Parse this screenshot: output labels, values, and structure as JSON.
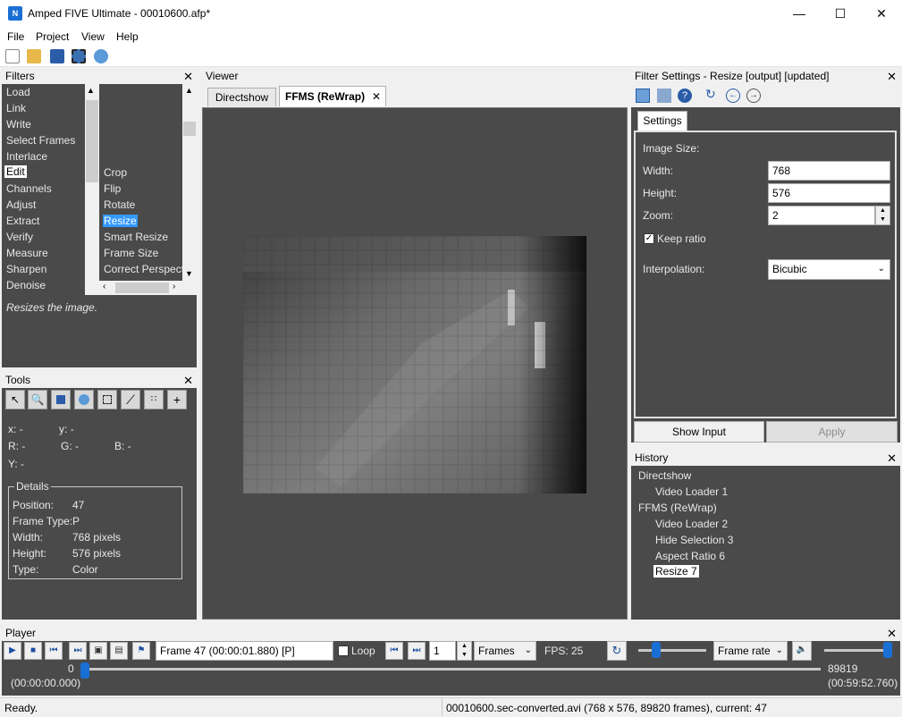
{
  "window": {
    "title": "Amped FIVE Ultimate - 00010600.afp*",
    "icon_text": "N",
    "minimize_icon": "minimize-icon",
    "maximize_icon": "maximize-icon",
    "close_icon": "close-icon"
  },
  "menu": [
    "File",
    "Project",
    "View",
    "Help"
  ],
  "toolbar": {
    "icons": [
      "new-file-icon",
      "open-folder-icon",
      "save-icon",
      "film-icon",
      "globe-icon"
    ]
  },
  "filters": {
    "title": "Filters",
    "categories": [
      "Load",
      "Link",
      "Write",
      "Select Frames",
      "Interlace",
      "Edit",
      "Channels",
      "Adjust",
      "Extract",
      "Verify",
      "Measure",
      "Sharpen",
      "Denoise"
    ],
    "selected_category": "Edit",
    "items": [
      "Crop",
      "Flip",
      "Rotate",
      "Resize",
      "Smart Resize",
      "Frame Size",
      "Correct Perspect"
    ],
    "selected_item": "Resize",
    "description": "Resizes the image."
  },
  "tools": {
    "title": "Tools",
    "icons": [
      "pointer-icon",
      "zoom-icon",
      "picture-icon",
      "globe-icon",
      "rect-select-icon",
      "line-icon",
      "dots-icon",
      "crosshair-icon"
    ],
    "x_label": "x:",
    "x_value": "-",
    "y_label": "y:",
    "y_value": "-",
    "r_label": "R:",
    "r_value": "-",
    "g_label": "G:",
    "g_value": "-",
    "b_label": "B:",
    "b_value": "-",
    "Y_label": "Y:",
    "Y_value": "-",
    "details_title": "Details",
    "details": [
      {
        "label": "Position:",
        "value": "47"
      },
      {
        "label": "Frame Type:",
        "value": "P"
      },
      {
        "label": "Width:",
        "value": "768 pixels"
      },
      {
        "label": "Height:",
        "value": "576 pixels"
      },
      {
        "label": "Type:",
        "value": "Color"
      }
    ]
  },
  "viewer": {
    "title": "Viewer",
    "tabs": [
      "Directshow",
      "FFMS (ReWrap)"
    ],
    "active_tab": "FFMS (ReWrap)",
    "tab_close_icon": "close-icon"
  },
  "filter_settings": {
    "title": "Filter Settings - Resize [output] [updated]",
    "tab": "Settings",
    "image_size_label": "Image Size:",
    "width_label": "Width:",
    "width_value": "768",
    "height_label": "Height:",
    "height_value": "576",
    "zoom_label": "Zoom:",
    "zoom_value": "2",
    "keep_ratio_label": "Keep ratio",
    "keep_ratio_checked": true,
    "interpolation_label": "Interpolation:",
    "interpolation_value": "Bicubic",
    "show_input_label": "Show Input",
    "apply_label": "Apply"
  },
  "history": {
    "title": "History",
    "items": [
      {
        "label": "Directshow",
        "indent": false
      },
      {
        "label": "Video Loader 1",
        "indent": true
      },
      {
        "label": "FFMS (ReWrap)",
        "indent": false
      },
      {
        "label": "Video Loader 2",
        "indent": true
      },
      {
        "label": "Hide Selection 3",
        "indent": true
      },
      {
        "label": "Aspect Ratio 6",
        "indent": true
      },
      {
        "label": "Resize 7",
        "indent": true
      }
    ],
    "selected": "Resize 7"
  },
  "player": {
    "title": "Player",
    "frame_text": "Frame 47 (00:00:01.880) [P]",
    "loop_label": "Loop",
    "step_value": "1",
    "unit_value": "Frames",
    "fps_text": "FPS: 25",
    "rate_value": "Frame rate",
    "start_frame": "0",
    "start_time": "(00:00:00.000)",
    "end_frame": "89819",
    "end_time": "(00:59:52.760)",
    "position_fraction": 0.0005
  },
  "status": {
    "left": "Ready.",
    "right": "00010600.sec-converted.avi (768 x 576, 89820 frames), current: 47"
  }
}
